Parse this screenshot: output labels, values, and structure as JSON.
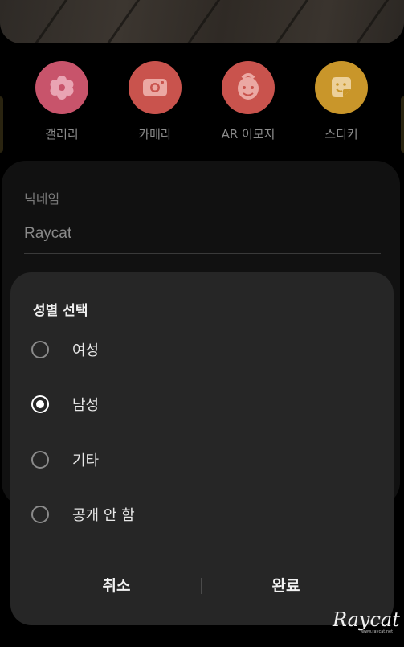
{
  "quick_actions": [
    {
      "label": "갤러리",
      "icon": "flower-icon",
      "color": "#c8546b"
    },
    {
      "label": "카메라",
      "icon": "camera-icon",
      "color": "#c9534d"
    },
    {
      "label": "AR 이모지",
      "icon": "face-icon",
      "color": "#c9534d"
    },
    {
      "label": "스티커",
      "icon": "sticker-icon",
      "color": "#c9962a"
    }
  ],
  "profile": {
    "nickname_label": "닉네임",
    "nickname_value": "Raycat"
  },
  "dialog": {
    "title": "성별 선택",
    "options": [
      {
        "label": "여성",
        "selected": false
      },
      {
        "label": "남성",
        "selected": true
      },
      {
        "label": "기타",
        "selected": false
      },
      {
        "label": "공개 안 함",
        "selected": false
      }
    ],
    "cancel_label": "취소",
    "confirm_label": "완료"
  },
  "watermark": {
    "text": "Raycat",
    "sub": "www.raycat.net"
  }
}
